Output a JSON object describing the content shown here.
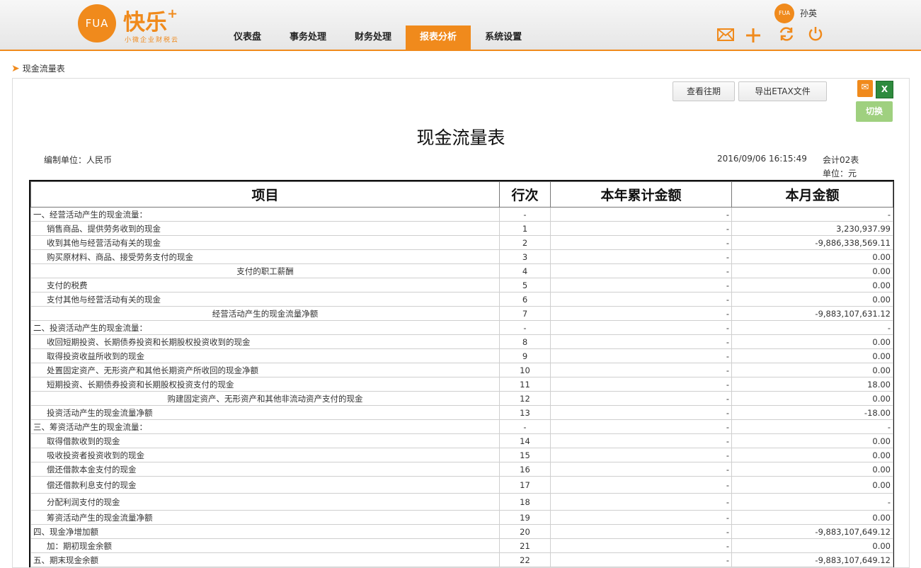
{
  "header": {
    "logo_text": "FUA",
    "brand": "快乐",
    "brand_plus": "+",
    "slogan": "小微企业财税云",
    "nav": [
      {
        "label": "仪表盘",
        "active": false
      },
      {
        "label": "事务处理",
        "active": false
      },
      {
        "label": "财务处理",
        "active": false
      },
      {
        "label": "报表分析",
        "active": true
      },
      {
        "label": "系统设置",
        "active": false
      }
    ],
    "user": {
      "avatar_text": "FUA",
      "name": "孙英"
    },
    "icons": [
      "mail-icon",
      "plus-icon",
      "refresh-icon",
      "power-icon"
    ]
  },
  "breadcrumb": {
    "label": "现金流量表"
  },
  "toolbar": {
    "history_label": "查看往期",
    "export_label": "导出ETAX文件",
    "switch_label": "切换"
  },
  "report": {
    "title": "现金流量表",
    "unit_org": "编制单位：人民币",
    "datetime": "2016/09/06 16:15:49",
    "form_no": "会计02表",
    "currency": "单位：元",
    "columns": [
      "项目",
      "行次",
      "本年累计金额",
      "本月金额"
    ],
    "rows": [
      {
        "item": "一、经营活动产生的现金流量：",
        "line": "-",
        "year": "-",
        "month": "-",
        "style": "section"
      },
      {
        "item": "销售商品、提供劳务收到的现金",
        "line": "1",
        "year": "-",
        "month": "3,230,937.99",
        "style": "ind1"
      },
      {
        "item": "收到其他与经营活动有关的现金",
        "line": "2",
        "year": "-",
        "month": "-9,886,338,569.11",
        "style": "ind1"
      },
      {
        "item": "购买原材料、商品、接受劳务支付的现金",
        "line": "3",
        "year": "-",
        "month": "0.00",
        "style": "ind1"
      },
      {
        "item": "支付的职工薪酬",
        "line": "4",
        "year": "-",
        "month": "0.00",
        "style": "center"
      },
      {
        "item": "支付的税费",
        "line": "5",
        "year": "-",
        "month": "0.00",
        "style": "ind1"
      },
      {
        "item": "支付其他与经营活动有关的现金",
        "line": "6",
        "year": "-",
        "month": "0.00",
        "style": "ind1"
      },
      {
        "item": "经营活动产生的现金流量净额",
        "line": "7",
        "year": "-",
        "month": "-9,883,107,631.12",
        "style": "center"
      },
      {
        "item": "二、投资活动产生的现金流量：",
        "line": "-",
        "year": "-",
        "month": "-",
        "style": "section"
      },
      {
        "item": "收回短期投资、长期债券投资和长期股权投资收到的现金",
        "line": "8",
        "year": "-",
        "month": "0.00",
        "style": "ind1"
      },
      {
        "item": "取得投资收益所收到的现金",
        "line": "9",
        "year": "-",
        "month": "0.00",
        "style": "ind1"
      },
      {
        "item": "处置固定资产、无形资产和其他长期资产所收回的现金净额",
        "line": "10",
        "year": "-",
        "month": "0.00",
        "style": "ind1"
      },
      {
        "item": "短期投资、长期债券投资和长期股权投资支付的现金",
        "line": "11",
        "year": "-",
        "month": "18.00",
        "style": "ind1"
      },
      {
        "item": "购建固定资产、无形资产和其他非流动资产支付的现金",
        "line": "12",
        "year": "-",
        "month": "0.00",
        "style": "center"
      },
      {
        "item": "投资活动产生的现金流量净额",
        "line": "13",
        "year": "-",
        "month": "-18.00",
        "style": "ind1"
      },
      {
        "item": "三、筹资活动产生的现金流量：",
        "line": "-",
        "year": "-",
        "month": "-",
        "style": "section"
      },
      {
        "item": "取得借款收到的现金",
        "line": "14",
        "year": "-",
        "month": "0.00",
        "style": "ind1"
      },
      {
        "item": "吸收投资者投资收到的现金",
        "line": "15",
        "year": "-",
        "month": "0.00",
        "style": "ind1"
      },
      {
        "item": "偿还借款本金支付的现金",
        "line": "16",
        "year": "-",
        "month": "0.00",
        "style": "ind1"
      },
      {
        "item": "偿还借款利息支付的现金",
        "line": "17",
        "year": "-",
        "month": "0.00",
        "style": "ind1 tall"
      },
      {
        "item": "分配利润支付的现金",
        "line": "18",
        "year": "-",
        "month": "-",
        "style": "ind1 tall"
      },
      {
        "item": "筹资活动产生的现金流量净额",
        "line": "19",
        "year": "-",
        "month": "0.00",
        "style": "ind1"
      },
      {
        "item": "四、现金净增加额",
        "line": "20",
        "year": "-",
        "month": "-9,883,107,649.12",
        "style": "section"
      },
      {
        "item": "加：期初现金余额",
        "line": "21",
        "year": "-",
        "month": "0.00",
        "style": "ind1"
      },
      {
        "item": "五、期末现金余额",
        "line": "22",
        "year": "-",
        "month": "-9,883,107,649.12",
        "style": "section"
      }
    ]
  }
}
